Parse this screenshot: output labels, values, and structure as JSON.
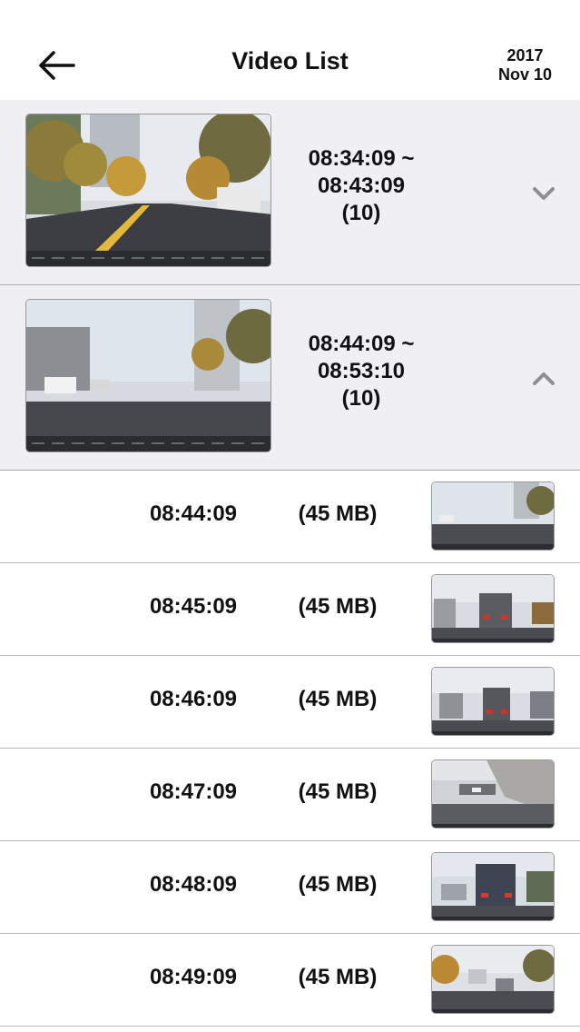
{
  "header": {
    "title": "Video List",
    "date_year": "2017",
    "date_day": "Nov 10",
    "back_icon": "arrow-left-icon"
  },
  "groups": [
    {
      "range_line1": "08:34:09 ~",
      "range_line2": "08:43:09",
      "count": "(10)",
      "chevron_icon": "chevron-down-icon",
      "expanded": false
    },
    {
      "range_line1": "08:44:09 ~",
      "range_line2": "08:53:10",
      "count": "(10)",
      "chevron_icon": "chevron-up-icon",
      "expanded": true
    }
  ],
  "files": [
    {
      "time": "08:44:09",
      "size": "(45 MB)"
    },
    {
      "time": "08:45:09",
      "size": "(45 MB)"
    },
    {
      "time": "08:46:09",
      "size": "(45 MB)"
    },
    {
      "time": "08:47:09",
      "size": "(45 MB)"
    },
    {
      "time": "08:48:09",
      "size": "(45 MB)"
    },
    {
      "time": "08:49:09",
      "size": "(45 MB)"
    }
  ],
  "colors": {
    "group_background": "#efeff4",
    "separator": "#b8b8bd",
    "text": "#111111",
    "chevron": "#8e8e93"
  }
}
